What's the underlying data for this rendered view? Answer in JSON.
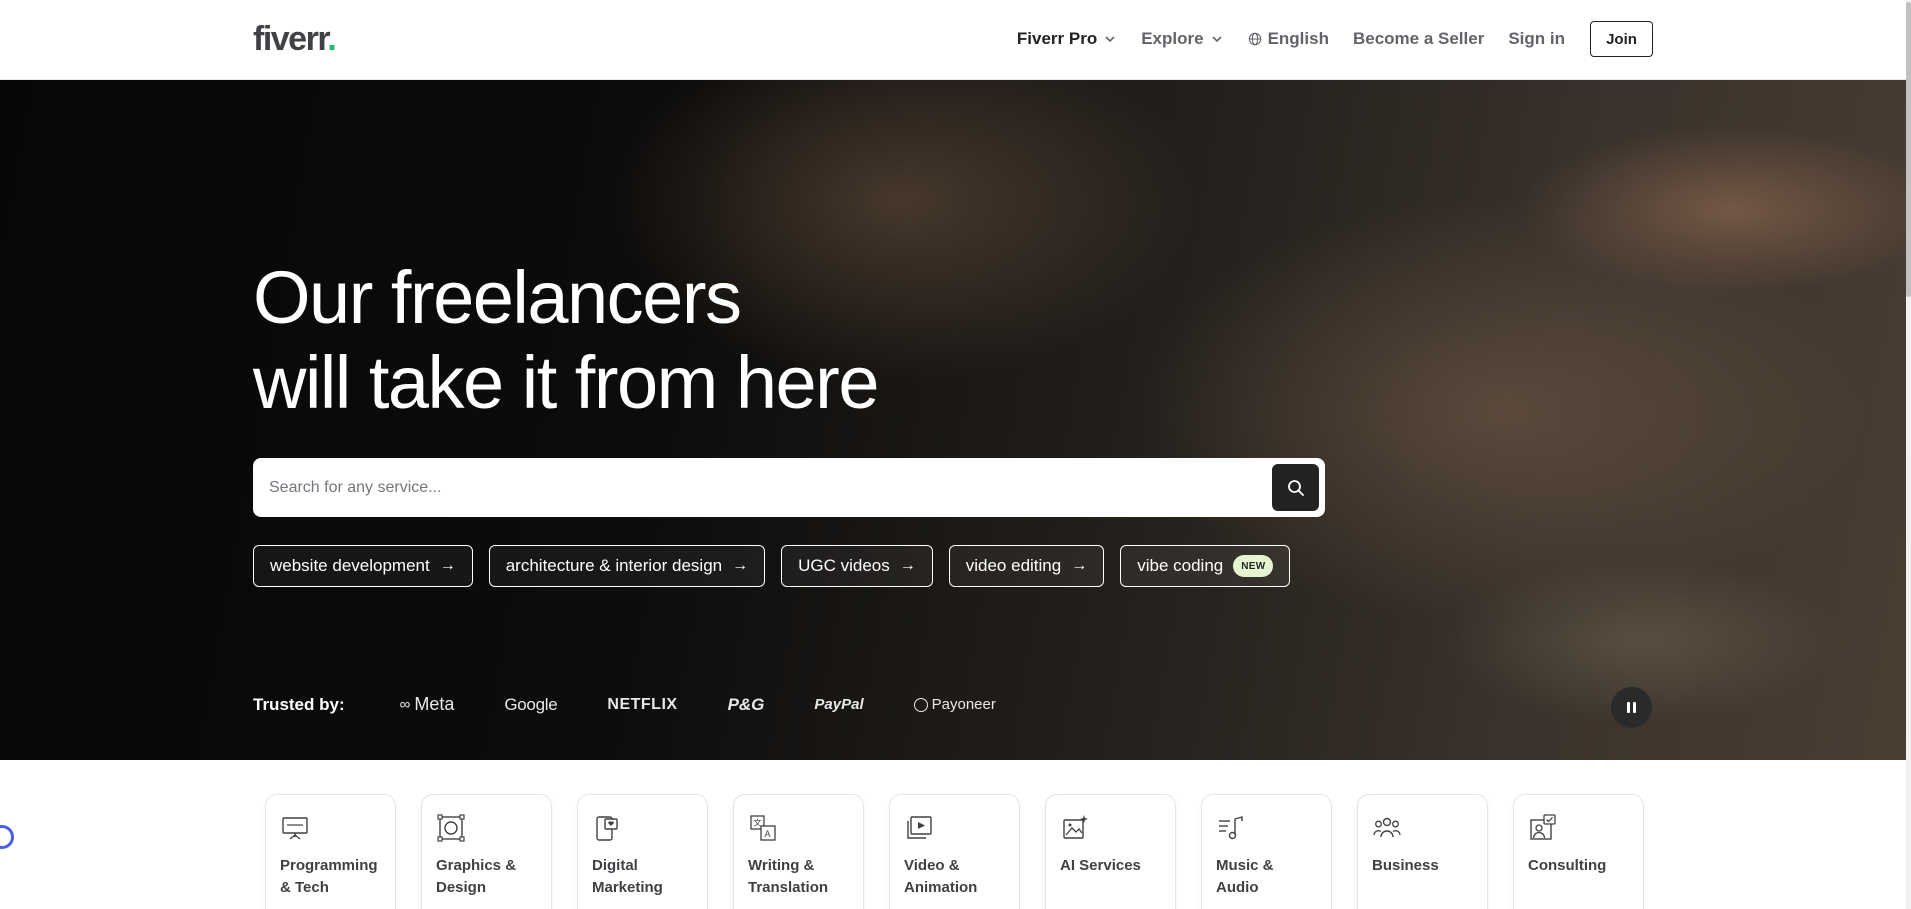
{
  "header": {
    "logo_text": "fiverr",
    "logo_dot": ".",
    "nav": {
      "fiverr_pro": "Fiverr Pro",
      "explore": "Explore",
      "language": "English",
      "become_seller": "Become a Seller",
      "sign_in": "Sign in",
      "join": "Join"
    }
  },
  "hero": {
    "title_line1": "Our freelancers",
    "title_line2": "will take it from here",
    "search": {
      "placeholder": "Search for any service...",
      "value": ""
    },
    "chips": [
      {
        "label": "website development",
        "suffix": "→"
      },
      {
        "label": "architecture & interior design",
        "suffix": "→"
      },
      {
        "label": "UGC videos",
        "suffix": "→"
      },
      {
        "label": "video editing",
        "suffix": "→"
      },
      {
        "label": "vibe coding",
        "badge": "NEW"
      }
    ],
    "trusted_label": "Trusted by:",
    "brands": [
      "Meta",
      "Google",
      "NETFLIX",
      "P&G",
      "PayPal",
      "Payoneer"
    ]
  },
  "categories": [
    {
      "label": "Programming & Tech",
      "icon": "monitor-presentation-icon"
    },
    {
      "label": "Graphics & Design",
      "icon": "design-frame-icon"
    },
    {
      "label": "Digital Marketing",
      "icon": "phone-heart-icon"
    },
    {
      "label": "Writing & Translation",
      "icon": "translate-icon"
    },
    {
      "label": "Video & Animation",
      "icon": "video-play-icon"
    },
    {
      "label": "AI Services",
      "icon": "ai-image-icon"
    },
    {
      "label": "Music & Audio",
      "icon": "music-note-icon"
    },
    {
      "label": "Business",
      "icon": "people-group-icon"
    },
    {
      "label": "Consulting",
      "icon": "consulting-chat-icon"
    }
  ],
  "colors": {
    "brand_green": "#1dbf73",
    "text_dark": "#222325",
    "text_grey": "#62646a",
    "badge_bg": "#e4f5d0"
  }
}
